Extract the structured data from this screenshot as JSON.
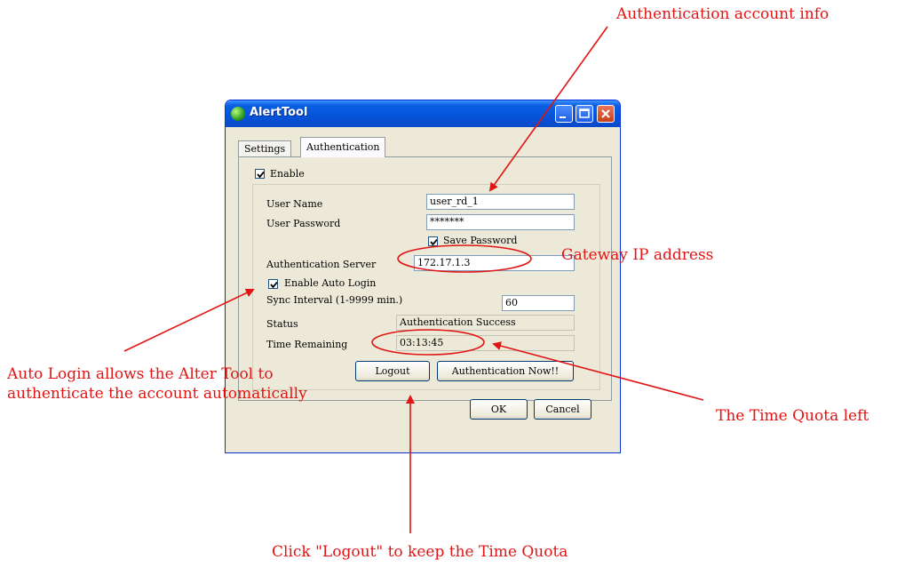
{
  "window": {
    "title": "AlertTool"
  },
  "tabs": [
    {
      "label": "Settings"
    },
    {
      "label": "Authentication"
    }
  ],
  "form": {
    "enable_label": "Enable",
    "user_name_label": "User Name",
    "user_name_value": "user_rd_1",
    "user_password_label": "User Password",
    "user_password_value": "*******",
    "save_password_label": "Save Password",
    "auth_server_label": "Authentication Server",
    "auth_server_value": "172.17.1.3",
    "enable_auto_login_label": "Enable Auto Login",
    "sync_interval_label": "Sync Interval (1-9999 min.)",
    "sync_interval_value": "60",
    "status_label": "Status",
    "status_value": "Authentication Success",
    "time_remaining_label": "Time Remaining",
    "time_remaining_value": "03:13:45",
    "logout_label": "Logout",
    "auth_now_label": "Authentication Now!!"
  },
  "dialog_buttons": {
    "ok_label": "OK",
    "cancel_label": "Cancel"
  },
  "annotations": {
    "account_info": "Authentication account info",
    "gateway_ip": "Gateway IP address",
    "auto_login_line1": "Auto Login allows the Alter Tool to",
    "auto_login_line2": "authenticate the account automatically",
    "time_quota_left": "The Time Quota left",
    "logout_hint": "Click \"Logout\" to keep the Time Quota"
  },
  "colors": {
    "annotation": "#e21414",
    "titlebar": "#0553d8"
  }
}
